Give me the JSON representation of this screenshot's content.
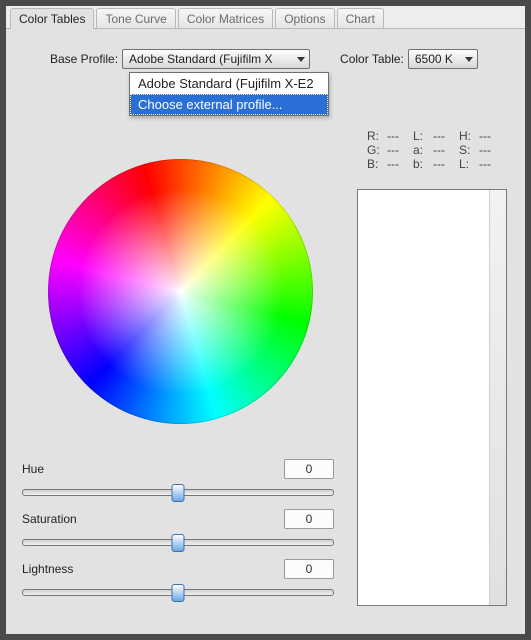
{
  "tabs": {
    "items": [
      "Color Tables",
      "Tone Curve",
      "Color Matrices",
      "Options",
      "Chart"
    ],
    "active_index": 0
  },
  "controls": {
    "base_profile_label": "Base Profile:",
    "base_profile_value": "Adobe Standard (Fujifilm X",
    "base_profile_options": [
      "Adobe Standard (Fujifilm X-E2",
      "Choose external profile..."
    ],
    "base_profile_highlight_index": 1,
    "color_table_label": "Color Table:",
    "color_table_value": "6500 K"
  },
  "stats": {
    "rows": [
      {
        "a": {
          "k": "R:",
          "v": "---"
        },
        "b": {
          "k": "L:",
          "v": "---"
        },
        "c": {
          "k": "H:",
          "v": "---"
        }
      },
      {
        "a": {
          "k": "G:",
          "v": "---"
        },
        "b": {
          "k": "a:",
          "v": "---"
        },
        "c": {
          "k": "S:",
          "v": "---"
        }
      },
      {
        "a": {
          "k": "B:",
          "v": "---"
        },
        "b": {
          "k": "b:",
          "v": "---"
        },
        "c": {
          "k": "L:",
          "v": "---"
        }
      }
    ]
  },
  "sliders": {
    "hue": {
      "label": "Hue",
      "value": "0",
      "pos": 50
    },
    "saturation": {
      "label": "Saturation",
      "value": "0",
      "pos": 50
    },
    "lightness": {
      "label": "Lightness",
      "value": "0",
      "pos": 50
    }
  }
}
